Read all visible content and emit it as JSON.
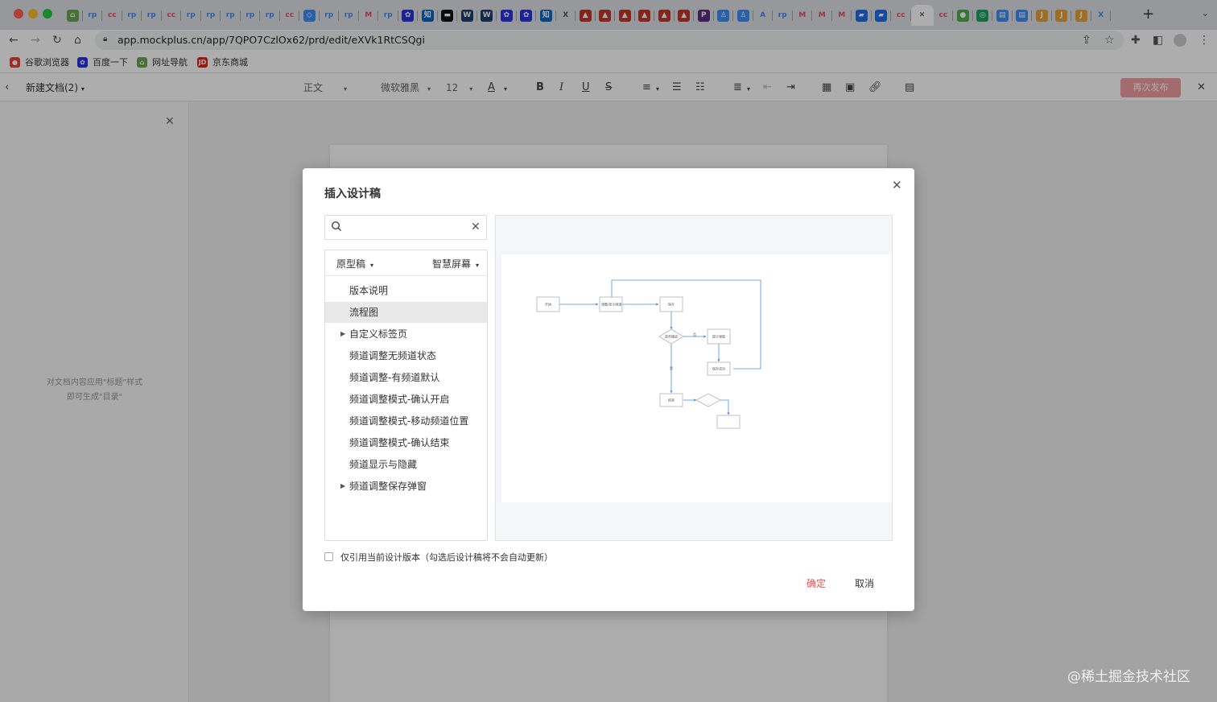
{
  "browser": {
    "tab_favicons": [
      {
        "icon": "house-icon",
        "glyph": "⌂",
        "color": "#6aa84f"
      },
      {
        "icon": "rp-icon",
        "glyph": "rp",
        "color": "#3f8ef7"
      },
      {
        "icon": "cc-icon",
        "glyph": "cc",
        "color": "#e8505b"
      },
      {
        "icon": "rp-icon",
        "glyph": "rp",
        "color": "#3f8ef7"
      },
      {
        "icon": "rp-icon",
        "glyph": "rp",
        "color": "#3f8ef7"
      },
      {
        "icon": "cc-icon",
        "glyph": "cc",
        "color": "#e8505b"
      },
      {
        "icon": "rp-icon",
        "glyph": "rp",
        "color": "#3f8ef7"
      },
      {
        "icon": "rp-icon",
        "glyph": "rp",
        "color": "#3f8ef7"
      },
      {
        "icon": "rp-icon",
        "glyph": "rp",
        "color": "#3f8ef7"
      },
      {
        "icon": "rp-icon",
        "glyph": "rp",
        "color": "#3f8ef7"
      },
      {
        "icon": "rp-icon",
        "glyph": "rp",
        "color": "#3f8ef7"
      },
      {
        "icon": "cc-icon",
        "glyph": "cc",
        "color": "#e8505b"
      },
      {
        "icon": "diamond-icon",
        "glyph": "◇",
        "color": "#3f8ef7"
      },
      {
        "icon": "rp-icon",
        "glyph": "rp",
        "color": "#3f8ef7"
      },
      {
        "icon": "rp-icon",
        "glyph": "rp",
        "color": "#3f8ef7"
      },
      {
        "icon": "mail-icon",
        "glyph": "M",
        "color": "#e8505b"
      },
      {
        "icon": "rp-icon",
        "glyph": "rp",
        "color": "#3f8ef7"
      },
      {
        "icon": "baidu-icon",
        "glyph": "✿",
        "color": "#2932e1"
      },
      {
        "icon": "zhihu-icon",
        "glyph": "知",
        "color": "#0a66c2"
      },
      {
        "icon": "black-icon",
        "glyph": "▬",
        "color": "#111111"
      },
      {
        "icon": "vw-icon",
        "glyph": "W",
        "color": "#1d3d6b"
      },
      {
        "icon": "vw-icon",
        "glyph": "W",
        "color": "#1d3d6b"
      },
      {
        "icon": "baidu-icon",
        "glyph": "✿",
        "color": "#2932e1"
      },
      {
        "icon": "baidu-icon",
        "glyph": "✿",
        "color": "#2932e1"
      },
      {
        "icon": "zhihu-icon",
        "glyph": "知",
        "color": "#0a66c2"
      },
      {
        "icon": "x-icon",
        "glyph": "X",
        "color": "#555555"
      },
      {
        "icon": "fox-icon",
        "glyph": "▲",
        "color": "#c0392b"
      },
      {
        "icon": "fox-icon",
        "glyph": "▲",
        "color": "#c0392b"
      },
      {
        "icon": "fox-icon",
        "glyph": "▲",
        "color": "#c0392b"
      },
      {
        "icon": "fox-icon",
        "glyph": "▲",
        "color": "#c0392b"
      },
      {
        "icon": "fox-icon",
        "glyph": "▲",
        "color": "#c0392b"
      },
      {
        "icon": "fox-icon",
        "glyph": "▲",
        "color": "#c0392b"
      },
      {
        "icon": "purple-icon",
        "glyph": "P",
        "color": "#5a2d82"
      },
      {
        "icon": "ghost-icon",
        "glyph": "♙",
        "color": "#3f8ef7"
      },
      {
        "icon": "ghost-icon",
        "glyph": "♙",
        "color": "#3f8ef7"
      },
      {
        "icon": "mountain-icon",
        "glyph": "A",
        "color": "#3f8ef7"
      },
      {
        "icon": "rp-icon",
        "glyph": "rp",
        "color": "#3f8ef7"
      },
      {
        "icon": "mail-icon",
        "glyph": "M",
        "color": "#e8505b"
      },
      {
        "icon": "mail-icon",
        "glyph": "M",
        "color": "#e8505b"
      },
      {
        "icon": "mail-icon",
        "glyph": "M",
        "color": "#e8505b"
      },
      {
        "icon": "chart-icon",
        "glyph": "▰",
        "color": "#1e6fe8"
      },
      {
        "icon": "chart-icon",
        "glyph": "▰",
        "color": "#1e6fe8"
      },
      {
        "icon": "cc-icon",
        "glyph": "cc",
        "color": "#e8505b"
      },
      {
        "icon": "close-icon",
        "glyph": "✕",
        "color": "#333333"
      },
      {
        "icon": "cc-icon",
        "glyph": "cc",
        "color": "#e8505b"
      },
      {
        "icon": "leaf-icon",
        "glyph": "●",
        "color": "#4caf50"
      },
      {
        "icon": "green-icon",
        "glyph": "◎",
        "color": "#21a366"
      },
      {
        "icon": "doc-icon",
        "glyph": "▤",
        "color": "#3f8ef7"
      },
      {
        "icon": "doc-icon",
        "glyph": "▤",
        "color": "#3f8ef7"
      },
      {
        "icon": "jd-icon",
        "glyph": "J",
        "color": "#e6a23c"
      },
      {
        "icon": "jd-icon",
        "glyph": "J",
        "color": "#e6a23c"
      },
      {
        "icon": "jd-icon",
        "glyph": "J",
        "color": "#e6a23c"
      },
      {
        "icon": "x-icon",
        "glyph": "X",
        "color": "#3f8ef7"
      }
    ],
    "url": "app.mockplus.cn/app/7QPO7CzlOx62/prd/edit/eXVk1RtCSQgi",
    "bookmarks": [
      {
        "label": "谷歌浏览器",
        "icon": "chrome-icon",
        "color": "#ea4335",
        "glyph": "●"
      },
      {
        "label": "百度一下",
        "icon": "baidu-icon",
        "color": "#2932e1",
        "glyph": "✿"
      },
      {
        "label": "网址导航",
        "icon": "nav-icon",
        "color": "#6aa84f",
        "glyph": "⌂"
      },
      {
        "label": "京东商城",
        "icon": "jd-icon",
        "color": "#e1251b",
        "glyph": "JD"
      }
    ]
  },
  "editor": {
    "doc_title": "新建文档(2)",
    "style_select": "正文",
    "font_select": "微软雅黑",
    "size_select": "12",
    "publish_label": "再次发布",
    "outline_hint_1": "对文档内容应用\"标题\"样式",
    "outline_hint_2": "即可生成\"目录\""
  },
  "modal": {
    "title": "插入设计稿",
    "search_placeholder": "",
    "search_value": "",
    "type_select": "原型稿",
    "screen_select": "智慧屏幕",
    "tree_items": [
      {
        "label": "版本说明",
        "expandable": false,
        "selected": false
      },
      {
        "label": "流程图",
        "expandable": false,
        "selected": true
      },
      {
        "label": "自定义标签页",
        "expandable": true,
        "selected": false
      },
      {
        "label": "频道调整无频道状态",
        "expandable": false,
        "selected": false
      },
      {
        "label": "频道调整-有频道默认",
        "expandable": false,
        "selected": false
      },
      {
        "label": "频道调整模式-确认开启",
        "expandable": false,
        "selected": false
      },
      {
        "label": "频道调整模式-移动频道位置",
        "expandable": false,
        "selected": false
      },
      {
        "label": "频道调整模式-确认结束",
        "expandable": false,
        "selected": false
      },
      {
        "label": "频道显示与隐藏",
        "expandable": false,
        "selected": false
      },
      {
        "label": "频道调整保存弹窗",
        "expandable": true,
        "selected": false
      }
    ],
    "checkbox_label": "仅引用当前设计版本（勾选后设计稿将不会自动更新）",
    "checkbox_checked": false,
    "confirm_label": "确定",
    "cancel_label": "取消",
    "accent_color": "#e8505b",
    "flowchart_labels": {
      "start": "开始",
      "step1": "调整/显示频道",
      "save": "保存",
      "decision": "是否確認",
      "no_label": "否",
      "yes_label": "是",
      "hint": "提示弹窗",
      "success": "保存成功",
      "end": "结束"
    }
  },
  "watermark": "@稀土掘金技术社区"
}
